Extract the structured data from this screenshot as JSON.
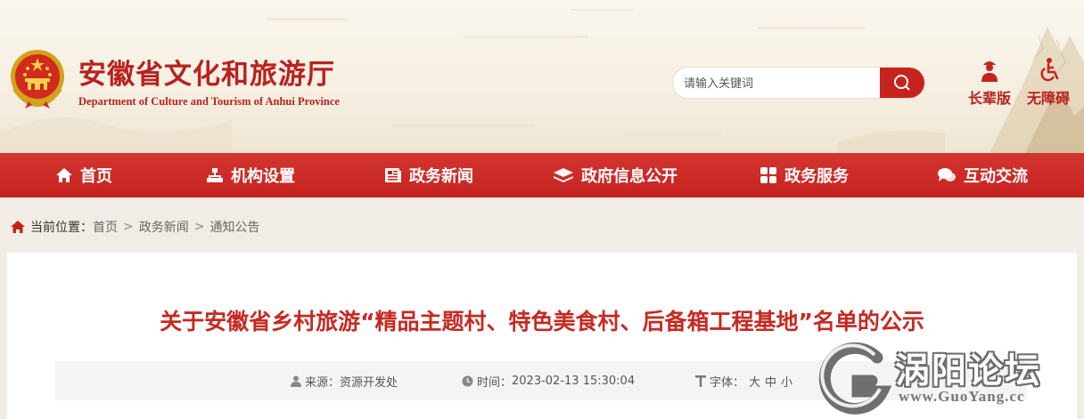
{
  "header": {
    "title": "安徽省文化和旅游厅",
    "subtitle": "Department of Culture and Tourism of Anhui Province",
    "search_placeholder": "请输入关键词",
    "elder_label": "长辈版",
    "accessibility_label": "无障碍"
  },
  "nav": {
    "items": [
      {
        "label": "首页",
        "icon": "home-icon"
      },
      {
        "label": "机构设置",
        "icon": "org-chart-icon"
      },
      {
        "label": "政务新闻",
        "icon": "news-icon"
      },
      {
        "label": "政府信息公开",
        "icon": "layers-icon"
      },
      {
        "label": "政务服务",
        "icon": "grid-icon"
      },
      {
        "label": "互动交流",
        "icon": "chat-icon"
      }
    ]
  },
  "breadcrumb": {
    "prefix": "当前位置：",
    "items": [
      "首页",
      "政务新闻",
      "通知公告"
    ],
    "separator": ">"
  },
  "article": {
    "title": "关于安徽省乡村旅游“精品主题村、特色美食村、后备箱工程基地”名单的公示",
    "source_label": "来源：",
    "source": "资源开发处",
    "time_label": "时间：",
    "time": "2023-02-13 15:30:04",
    "font_label": "字体：",
    "font_sizes": [
      "大",
      "中",
      "小"
    ]
  },
  "watermark": {
    "text": "涡阳论坛",
    "url": "www.GuoYang.cc"
  },
  "colors": {
    "brand_red": "#c6231f",
    "title_red": "#c52a22",
    "background": "#f1ede6"
  }
}
